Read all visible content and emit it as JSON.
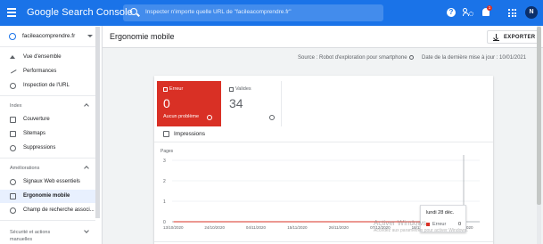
{
  "topbar": {
    "brand": "Google Search Console",
    "search_placeholder": "Inspecter n'importe quelle URL de \"facileacomprendre.fr\"",
    "notification_count": "1",
    "avatar_initial": "N",
    "color": "#1a73e8"
  },
  "sidebar": {
    "property": "facileacomprendre.fr",
    "items_top": [
      {
        "label": "Vue d'ensemble",
        "icon": "home-icon"
      },
      {
        "label": "Performances",
        "icon": "trend-icon"
      },
      {
        "label": "Inspection de l'URL",
        "icon": "search-icon"
      }
    ],
    "section_index": {
      "title": "Index",
      "items": [
        {
          "label": "Couverture",
          "icon": "coverage-icon"
        },
        {
          "label": "Sitemaps",
          "icon": "sitemap-icon"
        },
        {
          "label": "Suppressions",
          "icon": "removals-icon"
        }
      ]
    },
    "section_improvements": {
      "title": "Améliorations",
      "items": [
        {
          "label": "Signaux Web essentiels",
          "icon": "gauge-icon"
        },
        {
          "label": "Ergonomie mobile",
          "icon": "phone-icon",
          "active": true
        },
        {
          "label": "Champ de recherche associ...",
          "icon": "sitelinks-icon"
        }
      ]
    },
    "section_security": {
      "title": "Sécurité et actions manuelles"
    }
  },
  "page": {
    "title": "Ergonomie mobile",
    "export_label": "EXPORTER",
    "source": "Source : Robot d'exploration pour smartphone",
    "last_update": "Date de la dernière mise à jour : 10/01/2021"
  },
  "tiles": {
    "error": {
      "name": "Erreur",
      "count": "0",
      "sub": "Aucun problème",
      "color": "#d93025"
    },
    "valid": {
      "name": "Valides",
      "count": "34"
    }
  },
  "impressions_label": "Impressions",
  "tooltip": {
    "date": "lundi 28 déc.",
    "label": "Erreur",
    "value": "0"
  },
  "watermark": {
    "title": "Activer Windows",
    "sub": "Accédez aux paramètres pour activer Windows."
  },
  "chart_data": {
    "type": "line",
    "ylabel": "Pages",
    "ylim": [
      0,
      3
    ],
    "y_ticks": [
      "0",
      "1",
      "2",
      "3"
    ],
    "x_ticks": [
      "13/10/2020",
      "24/10/2020",
      "04/11/2020",
      "15/11/2020",
      "26/11/2020",
      "07/12/2020",
      "18/12/2020",
      "29/12/2020"
    ],
    "series": [
      {
        "name": "Erreur",
        "color": "#d93025",
        "values": [
          0,
          0,
          0,
          0,
          0,
          0,
          0,
          0
        ]
      }
    ],
    "highlight_index": 7,
    "grid": true
  }
}
